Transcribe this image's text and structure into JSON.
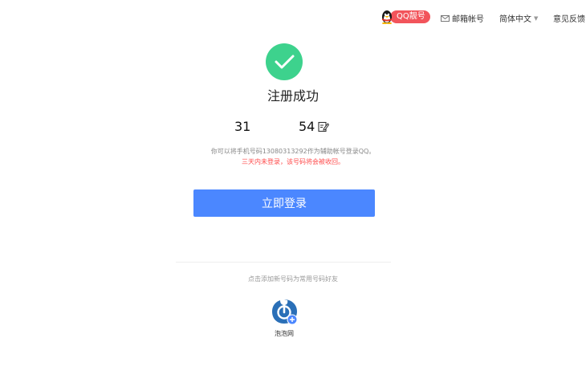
{
  "topbar": {
    "qq_badge": "QQ靓号",
    "mail_account": "邮箱帐号",
    "language": "简体中文",
    "feedback": "意见反馈"
  },
  "result": {
    "title": "注册成功",
    "account_part1": "31",
    "account_part2": "54"
  },
  "tips": {
    "phone_tip": "你可以将手机号码13080313292作为辅助帐号登录QQ。",
    "warning": "三天内未登录，该号码将会被收回。"
  },
  "login_button": "立即登录",
  "sub_tip": "点击添加新号码为常用号码好友",
  "app": {
    "label": "泡泡网"
  },
  "colors": {
    "success": "#3dd28d",
    "primary": "#4b87ff",
    "warning": "#ff4b4b",
    "badge": "#f2545b"
  }
}
